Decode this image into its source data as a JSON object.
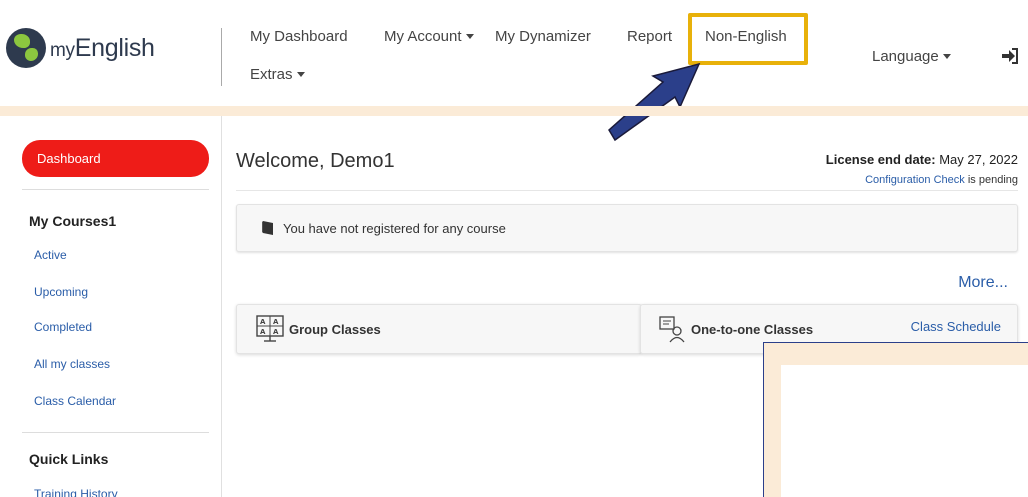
{
  "brand": {
    "logo_my": "my",
    "logo_main": "English"
  },
  "nav": {
    "my_dashboard": "My Dashboard",
    "my_account": "My Account",
    "my_dynamizer": "My Dynamizer",
    "report": "Report",
    "non_english": "Non-English",
    "extras": "Extras",
    "language": "Language"
  },
  "sidebar": {
    "dashboard": "Dashboard",
    "my_courses": "My Courses1",
    "items": [
      "Active",
      "Upcoming",
      "Completed",
      "All my classes",
      "Class Calendar"
    ],
    "quick_links": "Quick Links",
    "training_history": "Training History"
  },
  "main": {
    "welcome": "Welcome, Demo1",
    "license_label": "License end date:",
    "license_date": "May 27, 2022",
    "config_link": "Configuration Check",
    "config_status": "is pending",
    "notice": "You have not registered for any course",
    "more": "More...",
    "group_classes": "Group Classes",
    "one_to_one": "One-to-one Classes",
    "class_schedule": "Class Schedule"
  },
  "colors": {
    "accent": "#ee1c18",
    "link": "#2a5da8",
    "highlight": "#e8b10a",
    "band": "#fbebd7",
    "arrow": "#2b3f8a"
  },
  "icons": [
    "globe-logo-icon",
    "caret-down-icon",
    "sign-in-icon",
    "arrow-annotation",
    "book-icon",
    "group-classes-icon",
    "one-to-one-icon"
  ]
}
